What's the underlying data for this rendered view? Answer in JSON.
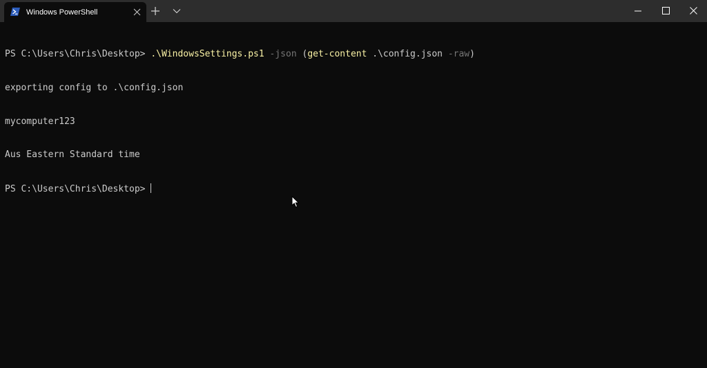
{
  "tab": {
    "title": "Windows PowerShell",
    "icon": "powershell-icon"
  },
  "titlebar": {
    "new_tab_icon": "plus-icon",
    "dropdown_icon": "chevron-down-icon",
    "minimize_icon": "minimize-icon",
    "maximize_icon": "maximize-icon",
    "close_icon": "close-icon"
  },
  "terminal": {
    "line1": {
      "prompt": "PS C:\\Users\\Chris\\Desktop> ",
      "script": ".\\WindowsSettings.ps1",
      "param1": "-json",
      "open": "(",
      "cmdlet": "get-content",
      "path": ".\\config.json",
      "param2": "-raw",
      "close": ")"
    },
    "line2": "exporting config to .\\config.json",
    "line3": "mycomputer123",
    "line4": "Aus Eastern Standard time",
    "line5_prompt": "PS C:\\Users\\Chris\\Desktop> "
  },
  "colors": {
    "background": "#0c0c0c",
    "titlebar": "#2d2d2d",
    "text": "#cccccc",
    "command": "#f9f1a5",
    "parameter": "#767676"
  }
}
